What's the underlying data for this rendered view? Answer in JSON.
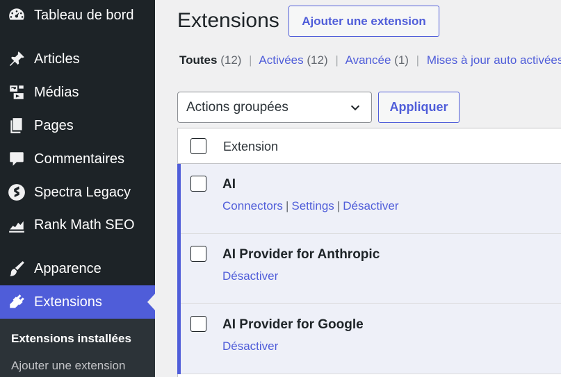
{
  "colors": {
    "accent": "#4f5dd9",
    "sidebar_bg": "#1d2327",
    "submenu_bg": "#2c3338",
    "row_active_bg": "#eef0f8"
  },
  "sidebar": {
    "items": [
      {
        "label": "Tableau de bord",
        "icon": "dashboard-icon"
      },
      {
        "label": "Articles",
        "icon": "pushpin-icon"
      },
      {
        "label": "Médias",
        "icon": "media-icon"
      },
      {
        "label": "Pages",
        "icon": "pages-icon"
      },
      {
        "label": "Commentaires",
        "icon": "comment-icon"
      },
      {
        "label": "Spectra Legacy",
        "icon": "spectra-icon"
      },
      {
        "label": "Rank Math SEO",
        "icon": "rank-math-icon"
      },
      {
        "label": "Apparence",
        "icon": "paintbrush-icon"
      },
      {
        "label": "Extensions",
        "icon": "plugin-icon"
      }
    ],
    "submenu": {
      "current": "Extensions installées",
      "other": "Ajouter une extension"
    }
  },
  "header": {
    "title": "Extensions",
    "add_button": "Ajouter une extension"
  },
  "filters": {
    "all": {
      "label": "Toutes",
      "count": "(12)"
    },
    "active": {
      "label": "Activées",
      "count": "(12)"
    },
    "advanced": {
      "label": "Avancée",
      "count": "(1)"
    },
    "auto_updates": {
      "label": "Mises à jour auto activées"
    }
  },
  "bulk": {
    "selected": "Actions groupées",
    "apply": "Appliquer"
  },
  "table": {
    "column_header": "Extension",
    "rows": [
      {
        "name": "AI",
        "actions": [
          "Connectors",
          "Settings",
          "Désactiver"
        ]
      },
      {
        "name": "AI Provider for Anthropic",
        "actions": [
          "Désactiver"
        ]
      },
      {
        "name": "AI Provider for Google",
        "actions": [
          "Désactiver"
        ]
      }
    ]
  }
}
